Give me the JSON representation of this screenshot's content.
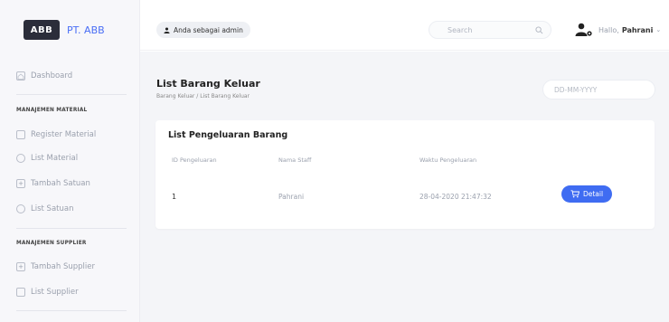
{
  "brand": {
    "logo_text": "ABB",
    "name": "PT. ABB"
  },
  "sidebar": {
    "dashboard": {
      "label": "Dashboard",
      "icon": "home-icon"
    },
    "section_material": "MANAJEMEN MATERIAL",
    "material_items": [
      {
        "label": "Register Material",
        "icon": "calendar-icon"
      },
      {
        "label": "List Material",
        "icon": "box-icon"
      },
      {
        "label": "Tambah Satuan",
        "icon": "plus-square-icon"
      },
      {
        "label": "List Satuan",
        "icon": "box-icon"
      }
    ],
    "section_supplier": "MANAJEMEN SUPPLIER",
    "supplier_items": [
      {
        "label": "Tambah Supplier",
        "icon": "file-plus-icon"
      },
      {
        "label": "List Supplier",
        "icon": "truck-icon"
      }
    ]
  },
  "topbar": {
    "role_label": "Anda sebagai admin",
    "search_placeholder": "Search",
    "greeting": "Hallo,",
    "username": "Pahrani"
  },
  "page": {
    "title": "List Barang Keluar",
    "breadcrumb": "Barang Keluar / List Barang Keluar",
    "date_placeholder": "DD-MM-YYYY"
  },
  "card": {
    "title": "List Pengeluaran Barang",
    "columns": [
      "ID Pengeluaran",
      "Nama Staff",
      "Waktu Pengeluaran"
    ],
    "rows": [
      {
        "id": "1",
        "staff": "Pahrani",
        "time": "28-04-2020 21:47:32",
        "action": "Detail"
      }
    ]
  },
  "colors": {
    "accent": "#3f6cf2",
    "sidebar_bg": "#f7f7fa",
    "main_bg": "#f4f5f8"
  }
}
